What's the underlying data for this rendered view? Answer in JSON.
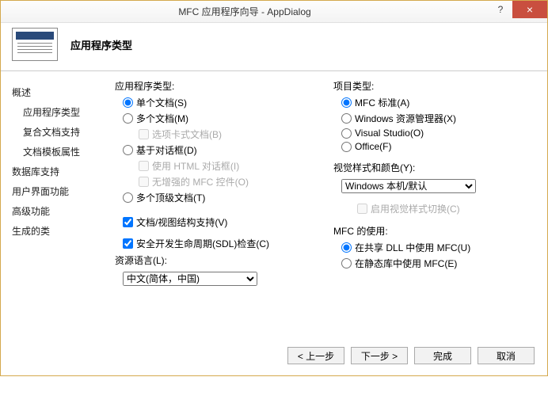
{
  "titlebar": {
    "title": "MFC 应用程序向导 - AppDialog",
    "help": "?",
    "close": "×"
  },
  "header": {
    "title": "应用程序类型"
  },
  "sidebar": {
    "overview": "概述",
    "appType": "应用程序类型",
    "compDoc": "复合文档支持",
    "tmplProps": "文档模板属性",
    "dbSupport": "数据库支持",
    "uiFeatures": "用户界面功能",
    "advFeatures": "高级功能",
    "genClasses": "生成的类"
  },
  "left": {
    "appTypeLabel": "应用程序类型:",
    "single": "单个文档(S)",
    "multiple": "多个文档(M)",
    "tabbed": "选项卡式文档(B)",
    "dialog": "基于对话框(D)",
    "useHtml": "使用 HTML 对话框(I)",
    "noEnhanced": "无增强的 MFC 控件(O)",
    "multiTop": "多个顶级文档(T)",
    "docView": "文档/视图结构支持(V)",
    "sdl": "安全开发生命周期(SDL)检查(C)",
    "resLangLabel": "资源语言(L):",
    "resLang": "中文(简体，中国)"
  },
  "right": {
    "projTypeLabel": "项目类型:",
    "mfcStd": "MFC 标准(A)",
    "winExplorer": "Windows 资源管理器(X)",
    "vs": "Visual Studio(O)",
    "office": "Office(F)",
    "visualStyleLabel": "视觉样式和颜色(Y):",
    "visualStyle": "Windows 本机/默认",
    "enableSwitch": "启用视觉样式切换(C)",
    "mfcUseLabel": "MFC 的使用:",
    "sharedDll": "在共享 DLL 中使用 MFC(U)",
    "staticLib": "在静态库中使用 MFC(E)"
  },
  "footer": {
    "prev": "< 上一步",
    "next": "下一步 >",
    "finish": "完成",
    "cancel": "取消"
  }
}
